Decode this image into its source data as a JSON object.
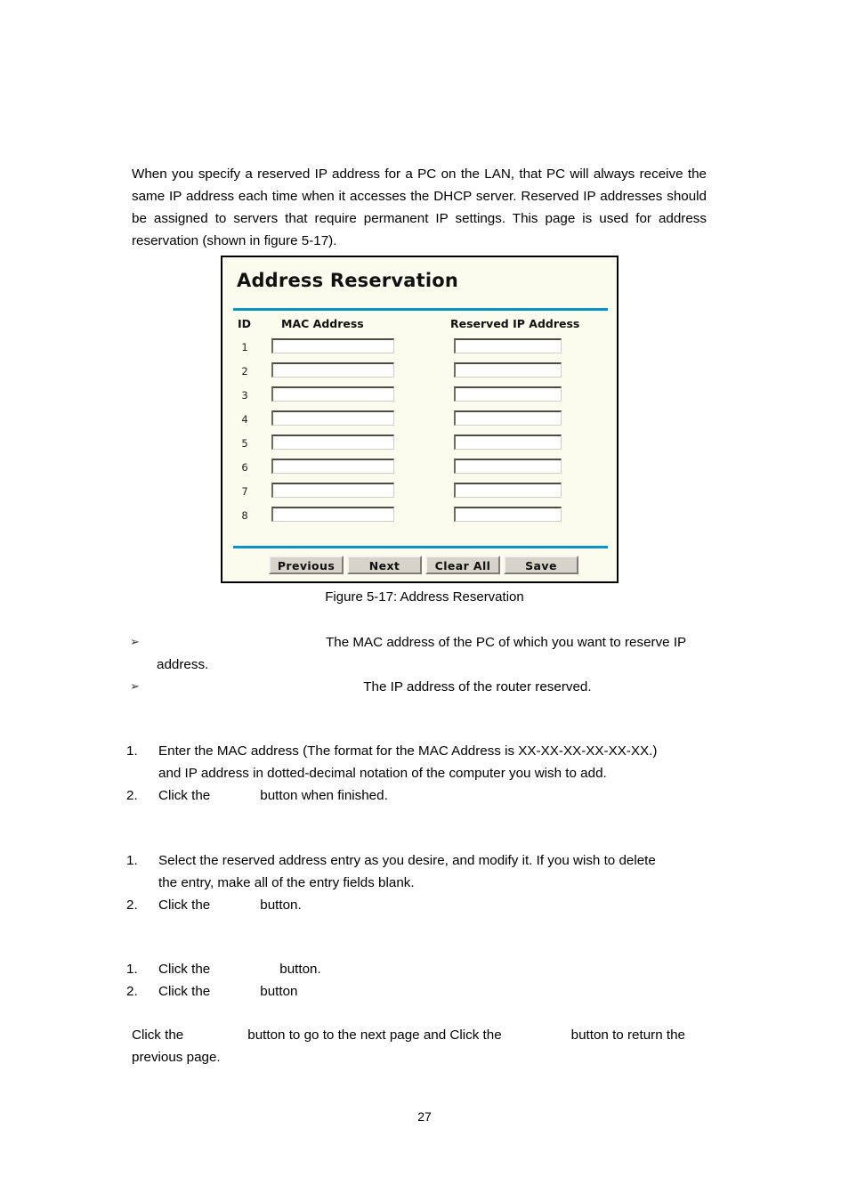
{
  "document": {
    "page_number": "27",
    "intro_paragraph": "When you specify a reserved IP address for a PC on the LAN, that PC will always receive the same IP address each time when it accesses the DHCP server. Reserved IP addresses should be assigned to servers that require permanent IP settings. This page is used for address reservation (shown in figure 5-17).",
    "figure_caption": "Figure 5-17: Address Reservation"
  },
  "figure": {
    "title": "Address Reservation",
    "accent_color": "#0a93c8",
    "background_color": "#fcfcee",
    "border_color": "#000000",
    "columns": {
      "id": "ID",
      "mac": "MAC Address",
      "ip": "Reserved IP Address"
    },
    "rows": [
      {
        "id": "1",
        "mac": "",
        "ip": ""
      },
      {
        "id": "2",
        "mac": "",
        "ip": ""
      },
      {
        "id": "3",
        "mac": "",
        "ip": ""
      },
      {
        "id": "4",
        "mac": "",
        "ip": ""
      },
      {
        "id": "5",
        "mac": "",
        "ip": ""
      },
      {
        "id": "6",
        "mac": "",
        "ip": ""
      },
      {
        "id": "7",
        "mac": "",
        "ip": ""
      },
      {
        "id": "8",
        "mac": "",
        "ip": ""
      }
    ],
    "buttons": {
      "previous": "Previous",
      "next": "Next",
      "clear_all": "Clear All",
      "save": "Save"
    }
  },
  "bullets": [
    {
      "marker": "➢",
      "text_line1": "The MAC address of the PC of which you want to reserve IP",
      "text_line2": "address."
    },
    {
      "marker": "➢",
      "text_line1": "The IP address of the router reserved.",
      "text_line2": ""
    }
  ],
  "procedures": {
    "add_steps": [
      {
        "num": "1.",
        "line1": "Enter the MAC address (The format for the MAC Address is XX-XX-XX-XX-XX-XX.)",
        "line2": "and IP address in dotted-decimal notation of the computer you wish to add."
      },
      {
        "num": "2.",
        "prefix": "Click the",
        "suffix": "button when finished."
      }
    ],
    "modify_steps": [
      {
        "num": "1.",
        "line1": "Select the reserved address entry as you desire, and modify it. If you wish to delete",
        "line2": "the entry, make all of the entry fields blank."
      },
      {
        "num": "2.",
        "prefix": "Click the",
        "suffix": "button."
      }
    ],
    "delete_steps": [
      {
        "num": "1.",
        "prefix": "Click the",
        "suffix": "button."
      },
      {
        "num": "2.",
        "prefix": "Click the",
        "suffix": "button"
      }
    ]
  },
  "navigation_note": {
    "part1": "Click the",
    "part2": "button to go to the next page and Click the",
    "part3": "button to return the",
    "part4": "previous page."
  }
}
